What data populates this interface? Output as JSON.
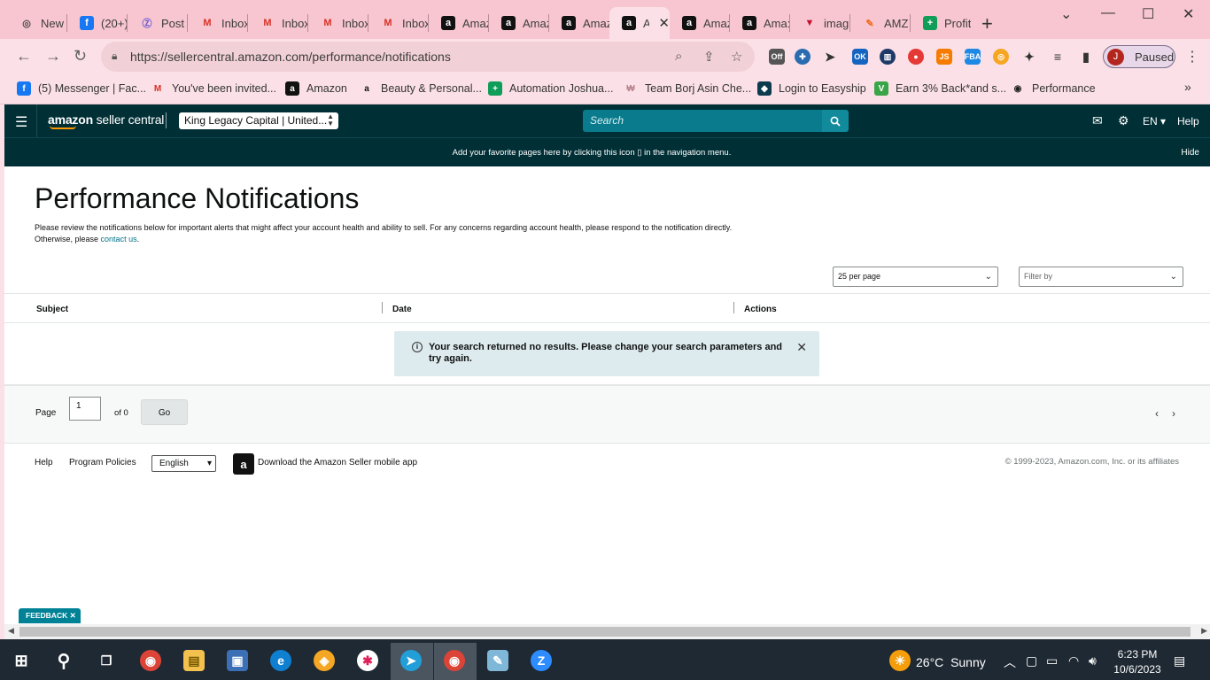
{
  "browser": {
    "tabs": [
      {
        "label": "New",
        "icon": "chrome-icon",
        "glyph": "◎",
        "color": "#4b4b4b",
        "bg": "transparent"
      },
      {
        "label": "(20+)",
        "icon": "facebook-icon",
        "glyph": "f",
        "color": "#fff",
        "bg": "#1877f2"
      },
      {
        "label": "Post",
        "icon": "post-icon",
        "glyph": "Ⓩ",
        "color": "#6b5bd6",
        "bg": "transparent"
      },
      {
        "label": "Inbox",
        "icon": "gmail-icon",
        "glyph": "M",
        "color": "#d93025",
        "bg": "transparent"
      },
      {
        "label": "Inbox",
        "icon": "gmail-icon",
        "glyph": "M",
        "color": "#d93025",
        "bg": "transparent"
      },
      {
        "label": "Inbox",
        "icon": "gmail-icon",
        "glyph": "M",
        "color": "#d93025",
        "bg": "transparent"
      },
      {
        "label": "Inbox",
        "icon": "gmail-icon",
        "glyph": "M",
        "color": "#d93025",
        "bg": "transparent"
      },
      {
        "label": "Amaz",
        "icon": "amazon-icon",
        "glyph": "a",
        "color": "#fff",
        "bg": "#111"
      },
      {
        "label": "Amaz",
        "icon": "amazon-icon",
        "glyph": "a",
        "color": "#fff",
        "bg": "#111"
      },
      {
        "label": "Amaz",
        "icon": "amazon-icon",
        "glyph": "a",
        "color": "#fff",
        "bg": "#111"
      },
      {
        "label": "A",
        "icon": "amazon-icon",
        "glyph": "a",
        "color": "#fff",
        "bg": "#111"
      },
      {
        "label": "Amaz",
        "icon": "amazon-icon",
        "glyph": "a",
        "color": "#fff",
        "bg": "#111"
      },
      {
        "label": "Ama:",
        "icon": "amazon-icon",
        "glyph": "a",
        "color": "#fff",
        "bg": "#111"
      },
      {
        "label": "imag",
        "icon": "image-icon",
        "glyph": "▼",
        "color": "#c8102e",
        "bg": "transparent"
      },
      {
        "label": "AMZ",
        "icon": "amz-icon",
        "glyph": "✎",
        "color": "#f36b21",
        "bg": "transparent"
      },
      {
        "label": "Profit",
        "icon": "sheets-icon",
        "glyph": "+",
        "color": "#fff",
        "bg": "#0f9d58"
      }
    ],
    "url": "https://sellercentral.amazon.com/performance/notifications",
    "profile_label": "Paused",
    "profile_initial": "J"
  },
  "bookmarks": [
    {
      "label": "(5) Messenger | Fac...",
      "icon": "facebook-icon",
      "glyph": "f",
      "color": "#fff",
      "bg": "#1877f2"
    },
    {
      "label": "You've been invited...",
      "icon": "gmail-icon",
      "glyph": "M",
      "color": "#d93025",
      "bg": "transparent"
    },
    {
      "label": "Amazon",
      "icon": "amazon-icon",
      "glyph": "a",
      "color": "#fff",
      "bg": "#111"
    },
    {
      "label": "Beauty & Personal...",
      "icon": "amazon-icon",
      "glyph": "a",
      "color": "#111",
      "bg": "transparent"
    },
    {
      "label": "Automation Joshua...",
      "icon": "sheets-icon",
      "glyph": "+",
      "color": "#fff",
      "bg": "#0f9d58"
    },
    {
      "label": "Team Borj Asin Che...",
      "icon": "team-icon",
      "glyph": "₩",
      "color": "#b8838d",
      "bg": "transparent"
    },
    {
      "label": "Login to Easyship",
      "icon": "easyship-icon",
      "glyph": "◆",
      "color": "#fff",
      "bg": "#0c3b4e"
    },
    {
      "label": "Earn 3% Back*and s...",
      "icon": "cashback-icon",
      "glyph": "V",
      "color": "#fff",
      "bg": "#3aa548"
    },
    {
      "label": "Performance",
      "icon": "globe-icon",
      "glyph": "◉",
      "color": "#222",
      "bg": "transparent"
    }
  ],
  "header": {
    "logo_strong": "amazon",
    "logo_light": " seller central",
    "account": "King Legacy Capital | United...",
    "search_placeholder": "Search",
    "language": "EN",
    "help": "Help"
  },
  "banner": {
    "message": "Add your favorite pages here by clicking this icon ▯ in the navigation menu.",
    "hide": "Hide"
  },
  "page": {
    "title": "Performance Notifications",
    "intro_line1": "Please review the notifications below for important alerts that might affect your account health and ability to sell. For any concerns regarding account health, please respond to the notification directly.",
    "intro_line2_prefix": "Otherwise, please ",
    "intro_link": "contact us",
    "intro_line2_suffix": ".",
    "per_page": "25 per page",
    "filter_placeholder": "Filter by",
    "columns": [
      "Subject",
      "Date",
      "Actions"
    ],
    "empty_message": "Your search returned no results. Please change your search parameters and try again.",
    "pager": {
      "label": "Page",
      "value": "1",
      "of": "of 0",
      "go": "Go"
    }
  },
  "footer": {
    "help": "Help",
    "policies": "Program Policies",
    "language": "English",
    "download": "Download the Amazon Seller mobile app",
    "copyright": "© 1999-2023, Amazon.com, Inc. or its affiliates"
  },
  "feedback": "FEEDBACK",
  "taskbar": {
    "temperature": "26°C",
    "weather": "Sunny",
    "time": "6:23 PM",
    "date": "10/6/2023"
  }
}
